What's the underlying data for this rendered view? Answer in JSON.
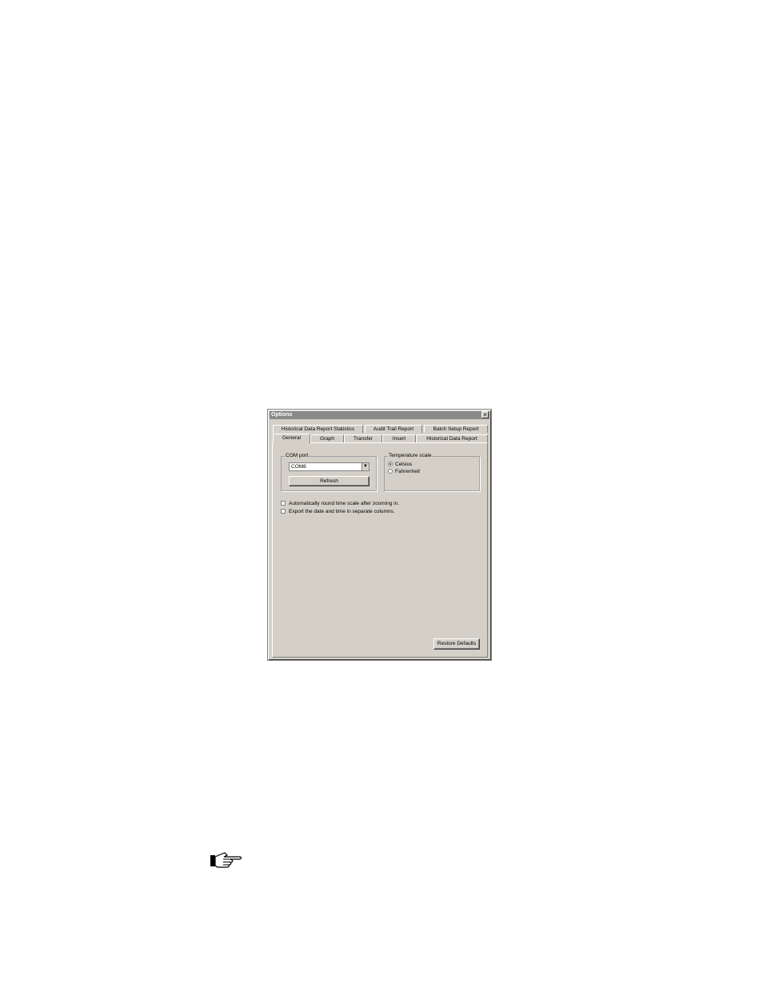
{
  "dialog": {
    "title": "Options",
    "close_glyph": "×"
  },
  "tabs": {
    "row1": [
      "Historical Data Report Statistics",
      "Audit Trail Report",
      "Batch Setup Report"
    ],
    "row2": [
      "General",
      "Graph",
      "Transfer",
      "Insert",
      "Historical Data Report"
    ],
    "active": "General"
  },
  "com_port": {
    "legend": "COM port",
    "selected": "COM8",
    "refresh_label": "Refresh"
  },
  "temperature_scale": {
    "legend": "Temperature scale",
    "options": [
      "Celsius",
      "Fahrenheit"
    ],
    "selected": "Celsius"
  },
  "checkboxes": [
    {
      "label": "Automatically round time scale after zooming in.",
      "checked": false
    },
    {
      "label": "Export the date and time in separate columns.",
      "checked": false
    }
  ],
  "restore_defaults_label": "Restore Defaults",
  "icons": {
    "note": "pointing-hand-icon"
  }
}
